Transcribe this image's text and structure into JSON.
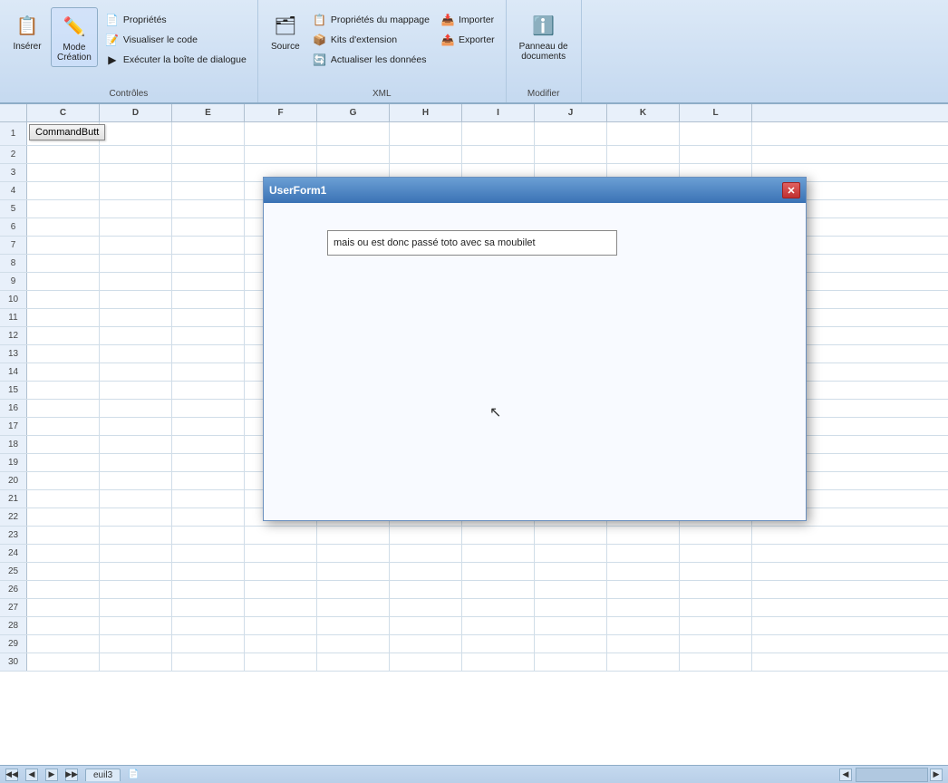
{
  "ribbon": {
    "sections": [
      {
        "id": "controles",
        "label": "Contrôles",
        "buttons_large": [
          {
            "id": "inserer",
            "label": "Insérer",
            "icon": "📋"
          },
          {
            "id": "mode-creation",
            "label": "Mode\nCréation",
            "icon": "✏️"
          }
        ],
        "buttons_small": [
          {
            "id": "proprietes",
            "label": "Propriétés",
            "icon": "📄"
          },
          {
            "id": "visualiser-code",
            "label": "Visualiser le code",
            "icon": "📝"
          },
          {
            "id": "executer-boite",
            "label": "Exécuter la boîte de dialogue",
            "icon": "▶"
          }
        ]
      },
      {
        "id": "xml",
        "label": "XML",
        "buttons_large": [
          {
            "id": "source",
            "label": "Source",
            "icon": "🗂"
          }
        ],
        "buttons_small": [
          {
            "id": "proprietes-mappage",
            "label": "Propriétés du mappage",
            "icon": "📋"
          },
          {
            "id": "kits-extension",
            "label": "Kits d'extension",
            "icon": "📦"
          },
          {
            "id": "actualiser-donnees",
            "label": "Actualiser les données",
            "icon": "🔄"
          },
          {
            "id": "importer",
            "label": "Importer",
            "icon": "📥"
          },
          {
            "id": "exporter",
            "label": "Exporter",
            "icon": "📤"
          }
        ]
      },
      {
        "id": "modifier",
        "label": "Modifier",
        "buttons_large": [
          {
            "id": "panneau-documents",
            "label": "Panneau de\ndocuments",
            "icon": "ℹ️"
          }
        ]
      }
    ]
  },
  "columns": [
    "C",
    "D",
    "E",
    "F",
    "G",
    "H",
    "I",
    "J",
    "K",
    "L"
  ],
  "cmd_button_label": "CommandButt",
  "dialog": {
    "title": "UserForm1",
    "close_label": "✕",
    "textbox_value": "mais ou est donc passé toto avec sa moubilet"
  },
  "status": {
    "tab_label": "euil3",
    "sheet_icon": "📄"
  }
}
